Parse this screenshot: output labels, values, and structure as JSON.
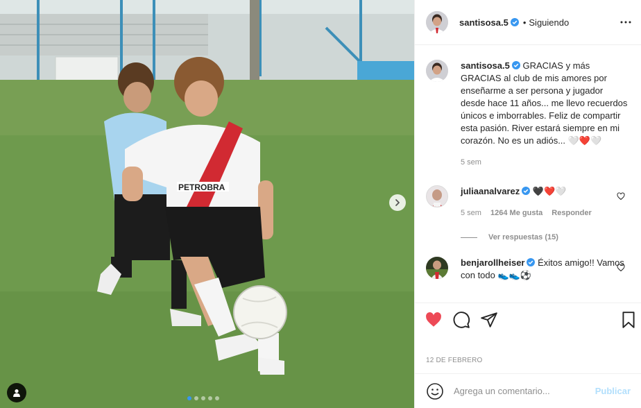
{
  "post": {
    "author": "santisosa.5",
    "follow_separator": "•",
    "follow_status": "Siguiendo",
    "accent_color": "#3897f0",
    "like_color": "#ed4956",
    "carousel": {
      "slides": 5,
      "active_index": 0
    },
    "media_icons": [
      "chevron-right-icon",
      "user-tag-icon"
    ]
  },
  "caption": {
    "username": "santisosa.5",
    "text": "GRACIAS y más GRACIAS al club de mis amores por enseñarme a ser persona y jugador desde hace 11 años... me llevo recuerdos únicos e imborrables. Feliz de compartir esta pasión. River estará siempre en mi corazón. No es un adiós... 🤍❤️🤍",
    "time": "5 sem"
  },
  "comments": [
    {
      "username": "juliaanalvarez",
      "text": "🖤❤️🤍",
      "time": "5 sem",
      "likes": "1264 Me gusta",
      "reply_label": "Responder",
      "replies_label": "Ver respuestas (15)"
    },
    {
      "username": "benjarollheiser",
      "text": "Éxitos amigo!! Vamos con todo 👟👟⚽"
    }
  ],
  "date": "12 DE FEBRERO",
  "composer": {
    "placeholder": "Agrega un comentario...",
    "publish_label": "Publicar"
  }
}
